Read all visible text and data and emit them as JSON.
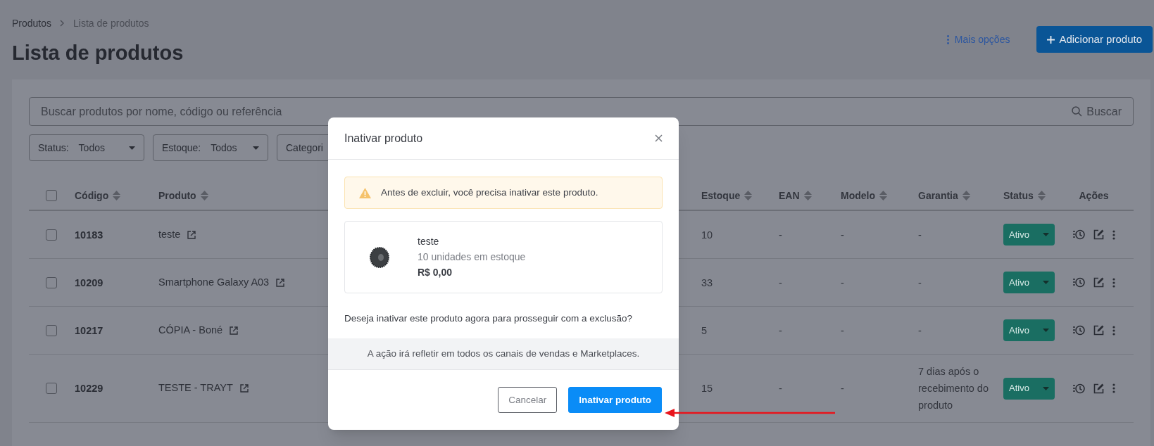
{
  "breadcrumb": [
    {
      "label": "Produtos"
    },
    {
      "label": "Lista de produtos"
    }
  ],
  "page_title": "Lista de produtos",
  "more_options": "Mais opções",
  "add_button": "Adicionar produto",
  "search": {
    "placeholder": "Buscar produtos por nome, código ou referência",
    "button": "Buscar"
  },
  "filters": [
    {
      "label": "Status:",
      "value": "Todos"
    },
    {
      "label": "Estoque:",
      "value": "Todos"
    },
    {
      "label": "Categori"
    }
  ],
  "table": {
    "select_all": {
      "checked": false
    },
    "columns": [
      {
        "label": "Código",
        "sortable": true
      },
      {
        "label": "Produto",
        "sortable": true
      },
      {
        "label": "Estoque",
        "sortable": true
      },
      {
        "label": "EAN",
        "sortable": true
      },
      {
        "label": "Modelo",
        "sortable": true
      },
      {
        "label": "Garantia",
        "sortable": true
      },
      {
        "label": "Status",
        "sortable": true
      },
      {
        "label": "Ações",
        "sortable": false
      }
    ],
    "rows": [
      {
        "checked": false,
        "code": "10183",
        "product": "teste",
        "stock": "10",
        "ean": "-",
        "model": "-",
        "warranty": "-",
        "status": "Ativo"
      },
      {
        "checked": false,
        "code": "10209",
        "product": "Smartphone Galaxy A03",
        "stock": "33",
        "ean": "-",
        "model": "-",
        "warranty": "-",
        "status": "Ativo"
      },
      {
        "checked": false,
        "code": "10217",
        "product": "CÓPIA - Boné",
        "stock": "5",
        "ean": "-",
        "model": "-",
        "warranty": "-",
        "status": "Ativo"
      },
      {
        "checked": false,
        "code": "10229",
        "product": "TESTE - TRAYT",
        "stock": "15",
        "ean": "-",
        "model": "-",
        "warranty": "7 dias após o recebimento do produto",
        "status": "Ativo"
      }
    ]
  },
  "modal": {
    "title": "Inativar produto",
    "alert": "Antes de excluir, você precisa inativar este produto.",
    "product": {
      "name": "teste",
      "stock": "10 unidades em estoque",
      "price": "R$ 0,00"
    },
    "question": "Deseja inativar este produto agora para prosseguir com a exclusão?",
    "note": "A ação irá refletir em todos os canais de vendas e Marketplaces.",
    "buttons": [
      {
        "label": "Cancelar",
        "kind": "secondary"
      },
      {
        "label": "Inativar produto",
        "kind": "primary"
      }
    ]
  }
}
